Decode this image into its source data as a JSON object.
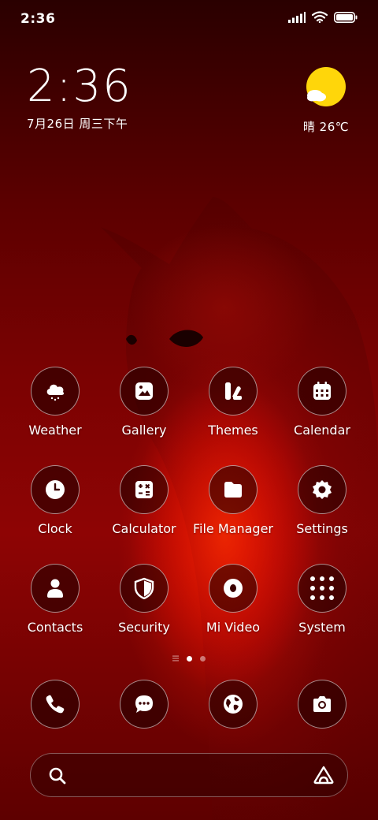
{
  "status_bar": {
    "time": "2:36",
    "battery_level": 1.0
  },
  "clock_widget": {
    "time": "2:36",
    "date": "7月26日 周三下午"
  },
  "weather_widget": {
    "text": "晴 26℃",
    "icon": "sunny-cloud-icon",
    "sun_color": "#FFD60A"
  },
  "apps": [
    {
      "label": "Weather",
      "icon": "weather-icon"
    },
    {
      "label": "Gallery",
      "icon": "gallery-icon"
    },
    {
      "label": "Themes",
      "icon": "themes-icon"
    },
    {
      "label": "Calendar",
      "icon": "calendar-icon"
    },
    {
      "label": "Clock",
      "icon": "clock-icon"
    },
    {
      "label": "Calculator",
      "icon": "calculator-icon"
    },
    {
      "label": "File Manager",
      "icon": "folder-icon"
    },
    {
      "label": "Settings",
      "icon": "gear-icon"
    },
    {
      "label": "Contacts",
      "icon": "contacts-icon"
    },
    {
      "label": "Security",
      "icon": "shield-icon"
    },
    {
      "label": "Mi Video",
      "icon": "video-icon"
    },
    {
      "label": "System",
      "icon": "folder-grid-icon"
    }
  ],
  "page_indicator": {
    "pages": 2,
    "current": 1
  },
  "dock": [
    {
      "icon": "phone-icon"
    },
    {
      "icon": "message-icon"
    },
    {
      "icon": "browser-icon"
    },
    {
      "icon": "camera-icon"
    }
  ],
  "search_bar": {
    "left_icon": "search-icon",
    "right_icon": "assistant-icon"
  }
}
